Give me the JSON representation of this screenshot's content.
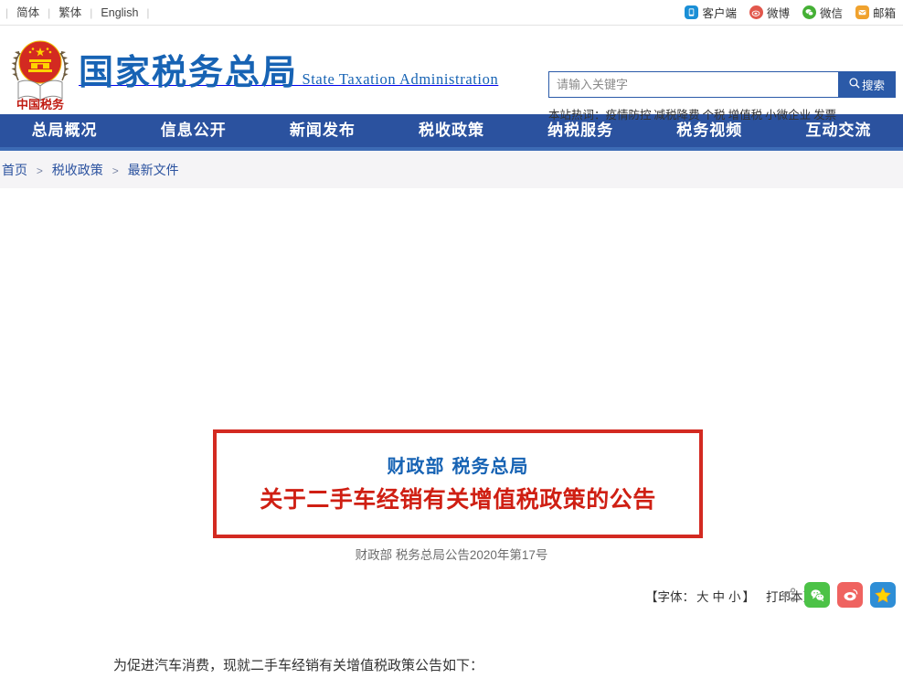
{
  "topbar": {
    "languages": [
      {
        "label": "简体",
        "name": "lang-simplified"
      },
      {
        "label": "繁体",
        "name": "lang-traditional"
      },
      {
        "label": "English",
        "name": "lang-english"
      }
    ],
    "separator": "|",
    "links": [
      {
        "label": "客户端",
        "icon": "client-app-icon",
        "color": "#1a8fd6"
      },
      {
        "label": "微博",
        "icon": "weibo-icon",
        "color": "#e2574c"
      },
      {
        "label": "微信",
        "icon": "wechat-icon",
        "color": "#45b035"
      },
      {
        "label": "邮箱",
        "icon": "mail-icon",
        "color": "#f0a22e"
      }
    ]
  },
  "header": {
    "logo_cn": "国家税务总局",
    "logo_en": "State Taxation Administration",
    "emblem_caption": "中国税务"
  },
  "search": {
    "placeholder": "请输入关键字",
    "value": "",
    "button_label": "搜索",
    "hot_label": "本站热词：",
    "hot_words": [
      "疫情防控",
      "减税降费",
      "个税",
      "增值税",
      "小微企业",
      "发票"
    ]
  },
  "nav": {
    "items": [
      {
        "label": "总局概况",
        "name": "nav-item-overview"
      },
      {
        "label": "信息公开",
        "name": "nav-item-disclosure"
      },
      {
        "label": "新闻发布",
        "name": "nav-item-news"
      },
      {
        "label": "税收政策",
        "name": "nav-item-policy"
      },
      {
        "label": "纳税服务",
        "name": "nav-item-service"
      },
      {
        "label": "税务视频",
        "name": "nav-item-video"
      },
      {
        "label": "互动交流",
        "name": "nav-item-interaction"
      }
    ]
  },
  "breadcrumb": {
    "items": [
      "首页",
      "税收政策",
      "最新文件"
    ],
    "separator": ">"
  },
  "article": {
    "subtitle": "财政部 税务总局",
    "title": "关于二手车经销有关增值税政策的公告",
    "doc_number": "财政部 税务总局公告2020年第17号",
    "font_prefix": "【字体：",
    "font_sizes": [
      "大",
      "中",
      "小"
    ],
    "font_suffix": "】",
    "print_label": "打印本页",
    "share_items": [
      {
        "name": "share-icon",
        "color": "#8d8d8d"
      },
      {
        "name": "wechat-share-icon",
        "color": "#4cc247"
      },
      {
        "name": "weibo-share-icon",
        "color": "#ef6360"
      },
      {
        "name": "qzone-share-icon",
        "color": "#2e8ed6"
      }
    ],
    "body_paragraph": "为促进汽车消费，现就二手车经销有关增值税政策公告如下："
  },
  "colors": {
    "nav_blue": "#2b529f",
    "nav_underline": "#3d6bb5",
    "logo_blue": "#1763b4",
    "title_red": "#cf1f13",
    "border_red": "#d32a21",
    "crumb_bg": "#f5f4f6"
  }
}
